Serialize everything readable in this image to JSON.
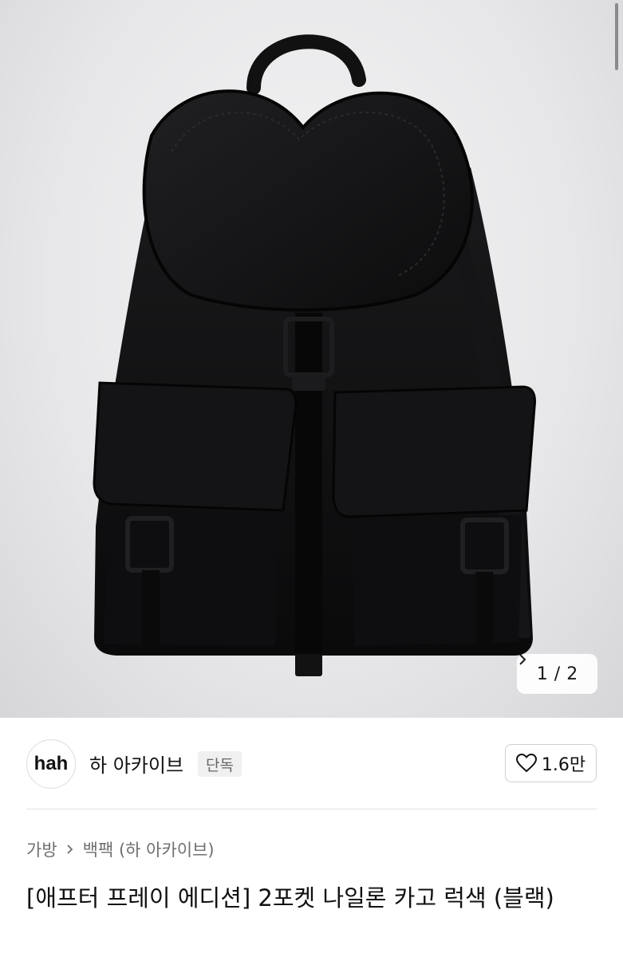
{
  "product_image": {
    "alt": "black nylon cargo backpack with two front pockets",
    "pager": {
      "current": "1",
      "separator": "/",
      "total": "2"
    }
  },
  "shop": {
    "avatar_text": "hah",
    "name": "하 아카이브",
    "badge": "단독",
    "likes": "1.6만"
  },
  "breadcrumb": {
    "category": "가방",
    "subcategory": "백팩 (하 아카이브)"
  },
  "product": {
    "title": "[애프터 프레이 에디션] 2포켓 나일론 카고 럭색 (블랙)"
  },
  "colors": {
    "bag": "#0d0d0e",
    "divider": "#e3e3e3",
    "badge_bg": "#f0f0f0"
  }
}
